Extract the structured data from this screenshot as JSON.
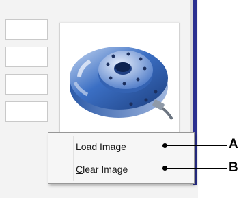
{
  "context_menu": {
    "items": [
      {
        "mnemonic": "L",
        "rest": "oad Image"
      },
      {
        "mnemonic": "C",
        "rest": "lear Image"
      }
    ]
  },
  "callouts": [
    "A",
    "B"
  ],
  "image": {
    "subject": "load-cell-sensor",
    "colors": {
      "primary": "#3b6fc4",
      "light": "#c9d9f2",
      "metal": "#8f9aa8"
    }
  },
  "colors": {
    "scrollbar_accent": "#2a2f8f",
    "menu_background": "#f6f6f6"
  }
}
